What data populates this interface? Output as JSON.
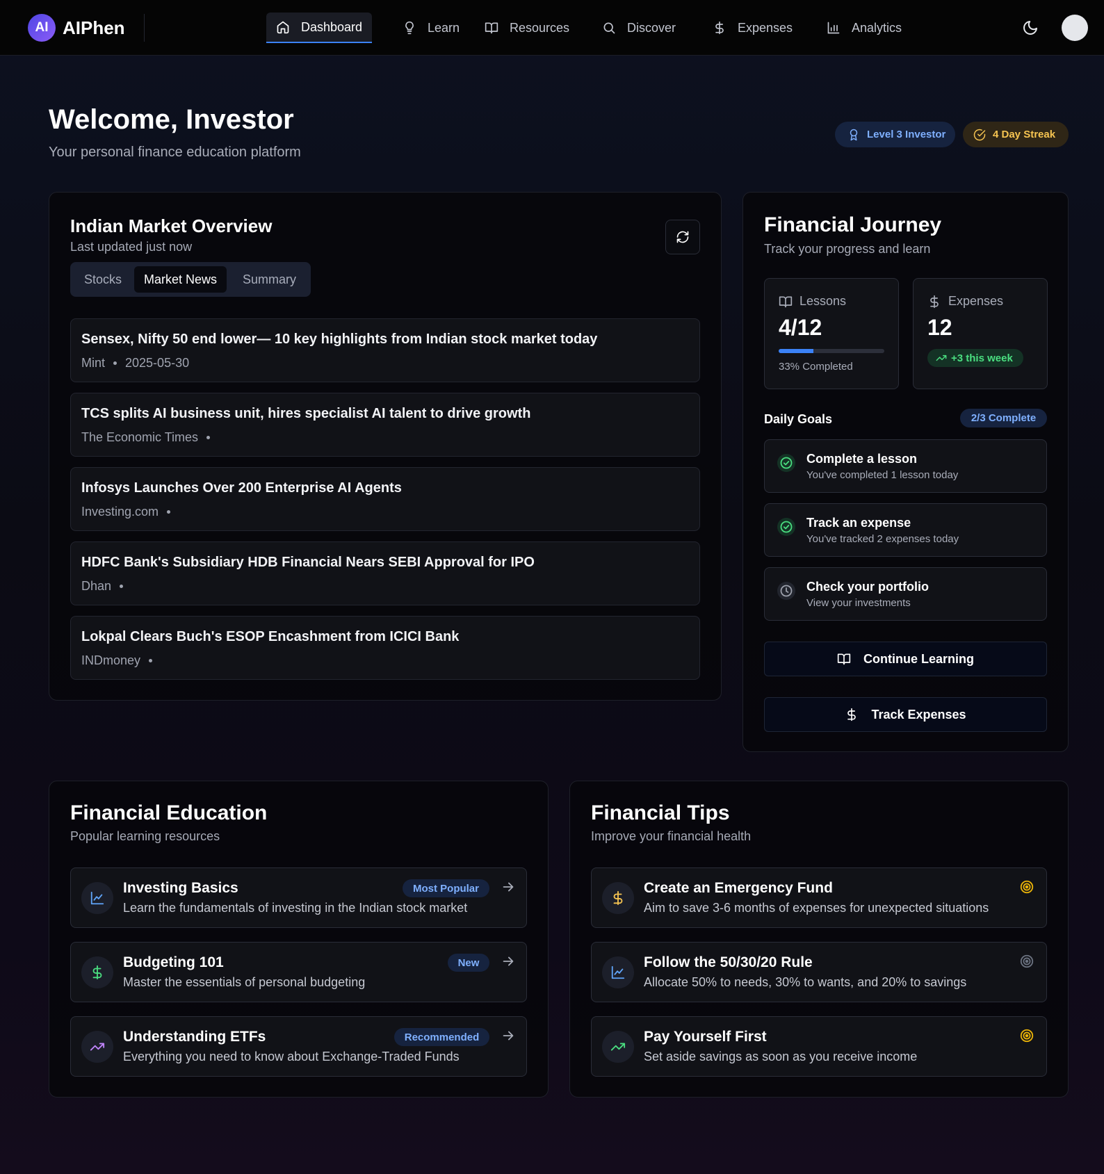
{
  "nav": {
    "brand_badge": "AI",
    "brand_name": "AIPhen",
    "items": [
      {
        "label": "Dashboard",
        "icon": "home-icon"
      },
      {
        "label": "Learn",
        "icon": "lightbulb-icon"
      },
      {
        "label": "Resources",
        "icon": "book-icon"
      },
      {
        "label": "Discover",
        "icon": "search-icon"
      },
      {
        "label": "Expenses",
        "icon": "dollar-icon"
      },
      {
        "label": "Analytics",
        "icon": "bar-chart-icon"
      }
    ],
    "active": "Dashboard",
    "theme_icon": "moon-icon"
  },
  "header": {
    "title": "Welcome, Investor",
    "subtitle": "Your personal finance education platform",
    "level_badge": "Level 3 Investor",
    "streak_badge": "4 Day Streak"
  },
  "market": {
    "title": "Indian Market Overview",
    "subtitle": "Last updated just now",
    "tabs": [
      "Stocks",
      "Market News",
      "Summary"
    ],
    "active_tab": "Market News",
    "news": [
      {
        "title": "Sensex, Nifty 50 end lower— 10 key highlights from Indian stock market today",
        "source": "Mint",
        "date": "2025-05-30"
      },
      {
        "title": "TCS splits AI business unit, hires specialist AI talent to drive growth",
        "source": "The Economic Times",
        "date": ""
      },
      {
        "title": "Infosys Launches Over 200 Enterprise AI Agents",
        "source": "Investing.com",
        "date": ""
      },
      {
        "title": "HDFC Bank's Subsidiary HDB Financial Nears SEBI Approval for IPO",
        "source": "Dhan",
        "date": ""
      },
      {
        "title": "Lokpal Clears Buch's ESOP Encashment from ICICI Bank",
        "source": "INDmoney",
        "date": ""
      }
    ]
  },
  "journey": {
    "title": "Financial Journey",
    "subtitle": "Track your progress and learn",
    "lessons": {
      "label": "Lessons",
      "value": "4/12",
      "progress": 0.33,
      "foot": "33% Completed"
    },
    "expenses": {
      "label": "Expenses",
      "value": "12",
      "week": "+3 this week"
    },
    "goals_title": "Daily Goals",
    "goals_badge": "2/3 Complete",
    "goals": [
      {
        "title": "Complete a lesson",
        "sub": "You've completed 1 lesson today",
        "done": true
      },
      {
        "title": "Track an expense",
        "sub": "You've tracked 2 expenses today",
        "done": true
      },
      {
        "title": "Check your portfolio",
        "sub": "View your investments",
        "done": false
      }
    ],
    "continue_label": "Continue Learning",
    "track_label": "Track Expenses"
  },
  "education": {
    "title": "Financial Education",
    "subtitle": "Popular learning resources",
    "items": [
      {
        "title": "Investing Basics",
        "sub": "Learn the fundamentals of investing in the Indian stock market",
        "badge": "Most Popular",
        "icon": "line-chart-icon"
      },
      {
        "title": "Budgeting 101",
        "sub": "Master the essentials of personal budgeting",
        "badge": "New",
        "icon": "dollar-icon"
      },
      {
        "title": "Understanding ETFs",
        "sub": "Everything you need to know about Exchange-Traded Funds",
        "badge": "Recommended",
        "icon": "trending-up-icon"
      }
    ]
  },
  "tips": {
    "title": "Financial Tips",
    "subtitle": "Improve your financial health",
    "items": [
      {
        "title": "Create an Emergency Fund",
        "sub": "Aim to save 3-6 months of expenses for unexpected situations",
        "icon": "dollar-icon",
        "target_color": "#eab308"
      },
      {
        "title": "Follow the 50/30/20 Rule",
        "sub": "Allocate 50% to needs, 30% to wants, and 20% to savings",
        "icon": "line-chart-icon",
        "target_color": "#6b7280"
      },
      {
        "title": "Pay Yourself First",
        "sub": "Set aside savings as soon as you receive income",
        "icon": "trending-up-icon",
        "target_color": "#eab308"
      }
    ]
  },
  "colors": {
    "accent": "#3b82f6",
    "success": "#4ade80",
    "warning": "#f6c451",
    "purple": "#a78bfa"
  }
}
